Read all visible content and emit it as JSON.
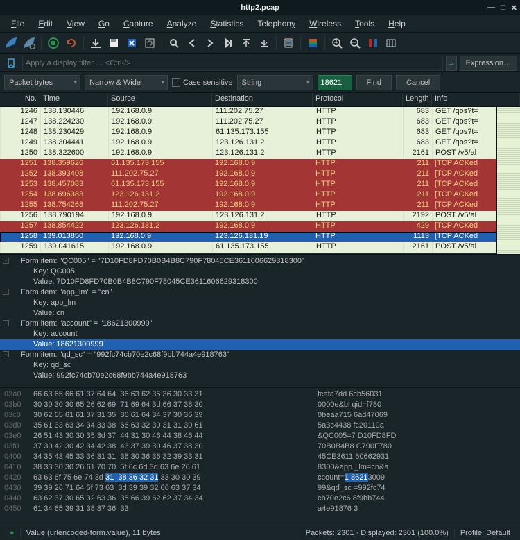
{
  "window": {
    "title": "http2.pcap",
    "min": "—",
    "max": "□",
    "close": "✕"
  },
  "menu": [
    "File",
    "Edit",
    "View",
    "Go",
    "Capture",
    "Analyze",
    "Statistics",
    "Telephony",
    "Wireless",
    "Tools",
    "Help"
  ],
  "filter": {
    "placeholder": "Apply a display filter … <Ctrl-/>",
    "expr_btn": "Expression…",
    "arrow": "→"
  },
  "search": {
    "packet_bytes": "Packet bytes",
    "narrow_wide": "Narrow & Wide",
    "case_sensitive": "Case sensitive",
    "string": "String",
    "value": "18621",
    "find": "Find",
    "cancel": "Cancel"
  },
  "headers": {
    "no": "No.",
    "time": "Time",
    "src": "Source",
    "dst": "Destination",
    "proto": "Protocol",
    "len": "Length",
    "info": "Info"
  },
  "packets": [
    {
      "no": "1246",
      "time": "138.130446",
      "src": "192.168.0.9",
      "dst": "111.202.75.27",
      "proto": "HTTP",
      "len": "683",
      "info": "GET  /qos?t=",
      "cls": "r-green"
    },
    {
      "no": "1247",
      "time": "138.224230",
      "src": "192.168.0.9",
      "dst": "111.202.75.27",
      "proto": "HTTP",
      "len": "683",
      "info": "GET  /qos?t=",
      "cls": "r-green"
    },
    {
      "no": "1248",
      "time": "138.230429",
      "src": "192.168.0.9",
      "dst": "61.135.173.155",
      "proto": "HTTP",
      "len": "683",
      "info": "GET  /qos?t=",
      "cls": "r-green"
    },
    {
      "no": "1249",
      "time": "138.304441",
      "src": "192.168.0.9",
      "dst": "123.126.131.2",
      "proto": "HTTP",
      "len": "683",
      "info": "GET  /qos?t=",
      "cls": "r-green"
    },
    {
      "no": "1250",
      "time": "138.322600",
      "src": "192.168.0.9",
      "dst": "123.126.131.2",
      "proto": "HTTP",
      "len": "2161",
      "info": "POST /v5/al",
      "cls": "r-green"
    },
    {
      "no": "1251",
      "time": "138.359626",
      "src": "61.135.173.155",
      "dst": "192.168.0.9",
      "proto": "HTTP",
      "len": "211",
      "info": "[TCP ACKed",
      "cls": "r-red"
    },
    {
      "no": "1252",
      "time": "138.393408",
      "src": "111.202.75.27",
      "dst": "192.168.0.9",
      "proto": "HTTP",
      "len": "211",
      "info": "[TCP ACKed",
      "cls": "r-red"
    },
    {
      "no": "1253",
      "time": "138.457083",
      "src": "61.135.173.155",
      "dst": "192.168.0.9",
      "proto": "HTTP",
      "len": "211",
      "info": "[TCP ACKed",
      "cls": "r-red"
    },
    {
      "no": "1254",
      "time": "138.696383",
      "src": "123.126.131.2",
      "dst": "192.168.0.9",
      "proto": "HTTP",
      "len": "211",
      "info": "[TCP ACKed",
      "cls": "r-red"
    },
    {
      "no": "1255",
      "time": "138.754268",
      "src": "111.202.75.27",
      "dst": "192.168.0.9",
      "proto": "HTTP",
      "len": "211",
      "info": "[TCP ACKed",
      "cls": "r-red"
    },
    {
      "no": "1256",
      "time": "138.790194",
      "src": "192.168.0.9",
      "dst": "123.126.131.2",
      "proto": "HTTP",
      "len": "2192",
      "info": "POST /v5/al",
      "cls": "r-green"
    },
    {
      "no": "1257",
      "time": "138.854422",
      "src": "123.126.131.2",
      "dst": "192.168.0.9",
      "proto": "HTTP",
      "len": "429",
      "info": "[TCP ACKed",
      "cls": "r-red"
    },
    {
      "no": "1258",
      "time": "139.013850",
      "src": "192.168.0.9",
      "dst": "123.126.131.19",
      "proto": "HTTP",
      "len": "1113",
      "info": "[TCP ACKed",
      "cls": "r-blue r-sel"
    },
    {
      "no": "1259",
      "time": "139.041615",
      "src": "192.168.0.9",
      "dst": "61.135.173.155",
      "proto": "HTTP",
      "len": "2161",
      "info": "POST /v5/al",
      "cls": "r-green"
    }
  ],
  "details": [
    {
      "lvl": "root",
      "exp": true,
      "txt": "Form item: \"QC005\" = \"7D10FD8FD70B0B4B8C790F78045CE3611606629318300\""
    },
    {
      "lvl": "i1",
      "txt": "Key: QC005"
    },
    {
      "lvl": "i1",
      "txt": "Value: 7D10FD8FD70B0B4B8C790F78045CE3611606629318300"
    },
    {
      "lvl": "root",
      "exp": true,
      "txt": "Form item: \"app_lm\" = \"cn\""
    },
    {
      "lvl": "i1",
      "txt": "Key: app_lm"
    },
    {
      "lvl": "i1",
      "txt": "Value: cn"
    },
    {
      "lvl": "root",
      "exp": true,
      "txt": "Form item: \"account\" = \"18621300999\""
    },
    {
      "lvl": "i1",
      "txt": "Key: account"
    },
    {
      "lvl": "i1",
      "txt": "Value: 18621300999",
      "hl": true
    },
    {
      "lvl": "root",
      "exp": true,
      "txt": "Form item: \"qd_sc\" = \"992fc74cb70e2c68f9bb744a4e918763\""
    },
    {
      "lvl": "i1",
      "txt": "Key: qd_sc"
    },
    {
      "lvl": "i1",
      "txt": "Value: 992fc74cb70e2c68f9bb744a4e918763"
    }
  ],
  "hex": [
    {
      "off": "03a0",
      "b": "66 63 65 66 61 37 64 64  36 63 62 35 36 30 33 31",
      "a": "fcefa7dd 6cb56031"
    },
    {
      "off": "03b0",
      "b": "30 30 30 30 65 26 62 69  71 69 64 3d 66 37 38 30",
      "a": "0000e&bi qid=f780"
    },
    {
      "off": "03c0",
      "b": "30 62 65 61 61 37 31 35  36 61 64 34 37 30 36 39",
      "a": "0beaa715 6ad47069"
    },
    {
      "off": "03d0",
      "b": "35 61 33 63 34 34 33 38  66 63 32 30 31 31 30 61",
      "a": "5a3c4438 fc20110a"
    },
    {
      "off": "03e0",
      "b": "26 51 43 30 30 35 3d 37  44 31 30 46 44 38 46 44",
      "a": "&QC005=7 D10FD8FD"
    },
    {
      "off": "03f0",
      "b": "37 30 42 30 42 34 42 38  43 37 39 30 46 37 38 30",
      "a": "70B0B4B8 C790F780"
    },
    {
      "off": "0400",
      "b": "34 35 43 45 33 36 31 31  36 30 36 36 32 39 33 31",
      "a": "45CE3611 60662931"
    },
    {
      "off": "0410",
      "b": "38 33 30 30 26 61 70 70  5f 6c 6d 3d 63 6e 26 61",
      "a": "8300&app _lm=cn&a"
    },
    {
      "off": "0420",
      "b": "63 63 6f 75 6e 74 3d ",
      "b_hl": "31  38 36 32 31",
      "b2": " 33 30 30 39",
      "a": "ccount=",
      "a_hl": "1 8621",
      "a2": "3009"
    },
    {
      "off": "0430",
      "b": "39 39 26 71 64 5f 73 63  3d 39 39 32 66 63 37 34",
      "a": "99&qd_sc =992fc74"
    },
    {
      "off": "0440",
      "b": "63 62 37 30 65 32 63 36  38 66 39 62 62 37 34 34",
      "a": "cb70e2c6 8f9bb744"
    },
    {
      "off": "0450",
      "b": "61 34 65 39 31 38 37 36  33",
      "a": "a4e91876 3"
    }
  ],
  "status": {
    "left": "Value (urlencoded-form.value), 11 bytes",
    "mid": "Packets: 2301 · Displayed: 2301 (100.0%)",
    "right": "Profile: Default"
  }
}
